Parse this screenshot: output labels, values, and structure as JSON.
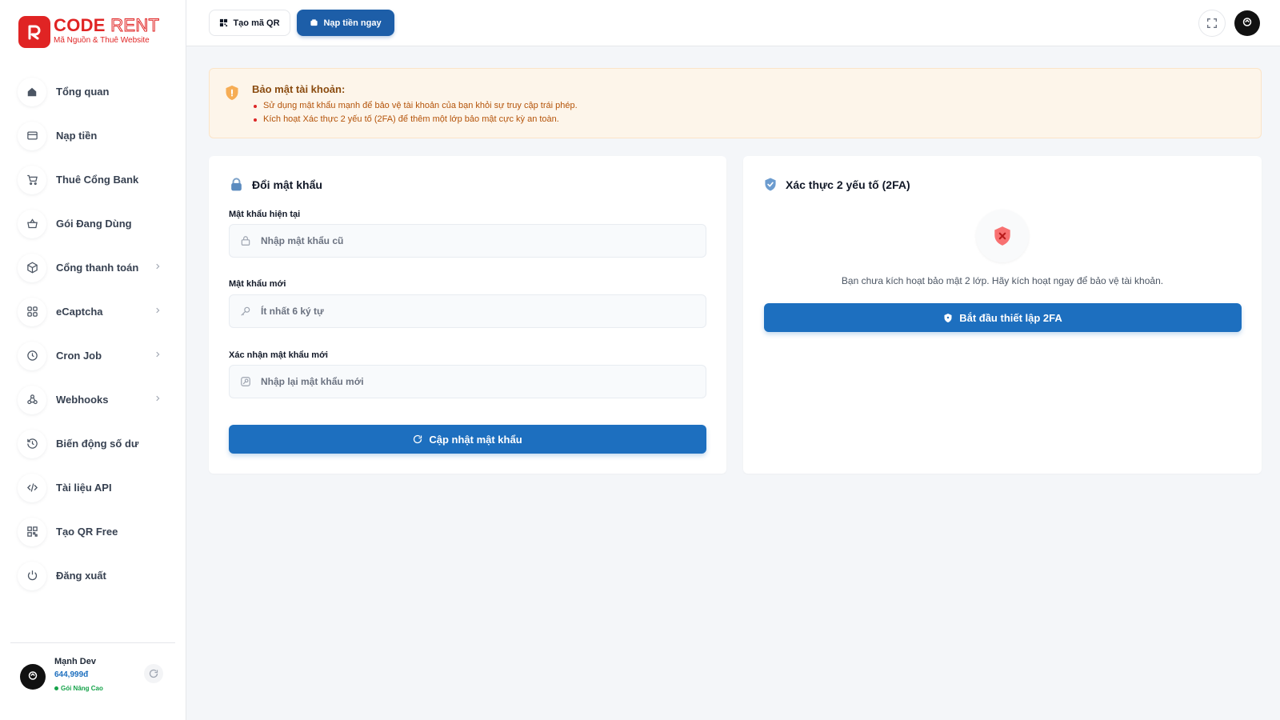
{
  "brand": {
    "name_part1": "CODE",
    "name_part2": "RENT",
    "tagline": "Mã Nguồn & Thuê Website",
    "color": "#e02424"
  },
  "sidebar": {
    "items": [
      {
        "label": "Tổng quan",
        "icon": "home-icon",
        "has_submenu": false
      },
      {
        "label": "Nạp tiền",
        "icon": "credit-card-icon",
        "has_submenu": false
      },
      {
        "label": "Thuê Cổng Bank",
        "icon": "cart-icon",
        "has_submenu": false
      },
      {
        "label": "Gói Đang Dùng",
        "icon": "basket-icon",
        "has_submenu": false
      },
      {
        "label": "Cổng thanh toán",
        "icon": "box-icon",
        "has_submenu": true
      },
      {
        "label": "eCaptcha",
        "icon": "grid-icon",
        "has_submenu": true
      },
      {
        "label": "Cron Job",
        "icon": "clock-icon",
        "has_submenu": true
      },
      {
        "label": "Webhooks",
        "icon": "webhook-icon",
        "has_submenu": true
      },
      {
        "label": "Biến động số dư",
        "icon": "history-icon",
        "has_submenu": false
      },
      {
        "label": "Tài liệu API",
        "icon": "code-icon",
        "has_submenu": false
      },
      {
        "label": "Tạo QR Free",
        "icon": "qr-code-icon",
        "has_submenu": false
      },
      {
        "label": "Đăng xuất",
        "icon": "power-icon",
        "has_submenu": false
      }
    ],
    "user": {
      "name": "Mạnh Dev",
      "balance": "644,999đ",
      "plan": "Gói Nâng Cao"
    }
  },
  "topbar": {
    "qr_button": "Tạo mã QR",
    "deposit_button": "Nạp tiền ngay"
  },
  "alert": {
    "title": "Bảo mật tài khoản:",
    "items": [
      "Sử dụng mật khẩu mạnh để bảo vệ tài khoản của bạn khỏi sự truy cập trái phép.",
      "Kích hoạt Xác thực 2 yếu tố (2FA) để thêm một lớp bảo mật cực kỳ an toàn."
    ]
  },
  "password_card": {
    "title": "Đổi mật khẩu",
    "fields": [
      {
        "label": "Mật khẩu hiện tại",
        "placeholder": "Nhập mật khẩu cũ",
        "value": ""
      },
      {
        "label": "Mật khẩu mới",
        "placeholder": "Ít nhất 6 ký tự",
        "value": ""
      },
      {
        "label": "Xác nhận mật khẩu mới",
        "placeholder": "Nhập lại mật khẩu mới",
        "value": ""
      }
    ],
    "submit_label": "Cập nhật mật khẩu"
  },
  "twofa_card": {
    "title": "Xác thực 2 yếu tố (2FA)",
    "message": "Bạn chưa kích hoạt bảo mật 2 lớp. Hãy kích hoạt ngay để bảo vệ tài khoản.",
    "button_label": "Bắt đầu thiết lập 2FA"
  },
  "colors": {
    "primary": "#1d6fbf",
    "alert_bg": "#fdf5ea",
    "alert_text": "#b45309",
    "danger": "#ef4444"
  }
}
